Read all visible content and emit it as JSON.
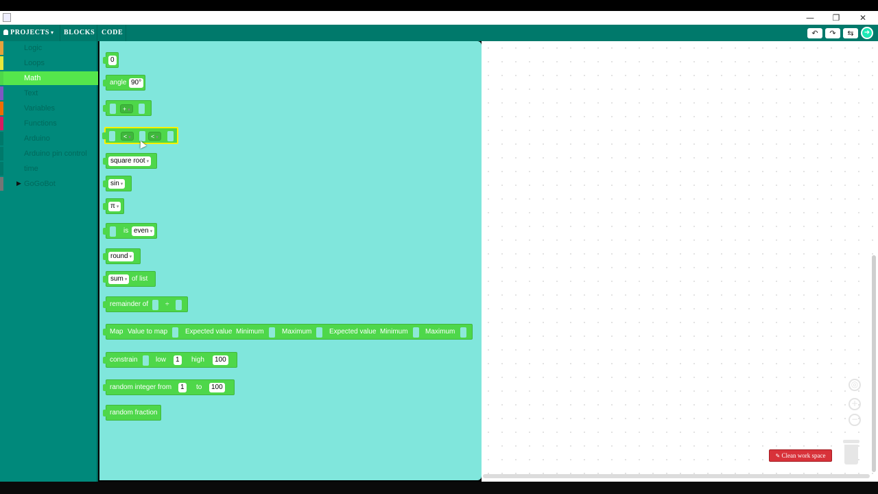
{
  "window": {
    "minimize": "—",
    "restore": "❐",
    "close": "✕"
  },
  "toolbar": {
    "projects_label": "PROJECTS",
    "projects_caret": "▾",
    "blocks_label": "BLOCKS",
    "code_label": "CODE",
    "undo_icon": "↶",
    "redo_icon": "↷",
    "connect_icon": "⇆",
    "go_icon": "➜"
  },
  "sidebar": {
    "categories": [
      {
        "label": "Logic",
        "color": "#e6a23c"
      },
      {
        "label": "Loops",
        "color": "#e6e63c"
      },
      {
        "label": "Math",
        "color": "#4ed74a",
        "selected": true
      },
      {
        "label": "Text",
        "color": "#7e57c2"
      },
      {
        "label": "Variables",
        "color": "#ef6c00"
      },
      {
        "label": "Functions",
        "color": "#d81b60"
      },
      {
        "label": "Arduino",
        "color": "#00897b"
      },
      {
        "label": "Arduino pin control",
        "color": "#00897b"
      },
      {
        "label": "time",
        "color": "#00897b"
      },
      {
        "label": "GoGoBot",
        "color": "#757575",
        "expandable": true
      }
    ]
  },
  "flyout": {
    "number": {
      "value": "0"
    },
    "angle": {
      "label": "angle",
      "value": "90°"
    },
    "arithmetic": {
      "op": "+"
    },
    "compare": {
      "op1": "<",
      "op2": "<"
    },
    "single": {
      "value": "square root"
    },
    "trig": {
      "value": "sin"
    },
    "constant": {
      "value": "π"
    },
    "number_property": {
      "label": "is",
      "value": "even"
    },
    "round": {
      "value": "round"
    },
    "on_list": {
      "value": "sum",
      "label": "of list"
    },
    "modulo": {
      "label": "remainder of",
      "op": "÷"
    },
    "map": {
      "labels": [
        "Map",
        "Value to map",
        "Expected value",
        "Minimum",
        "Maximum",
        "Expected value",
        "Minimum",
        "Maximum"
      ]
    },
    "constrain": {
      "label": "constrain",
      "low_label": "low",
      "low": "1",
      "high_label": "high",
      "high": "100"
    },
    "random_int": {
      "label": "random integer from",
      "from": "1",
      "to_label": "to",
      "to": "100"
    },
    "random_fraction": {
      "label": "random fraction"
    }
  },
  "workspace": {
    "recenter_icon": "◎",
    "zoom_in_icon": "+",
    "zoom_out_icon": "−",
    "clean_icon": "✎",
    "clean_label": "Clean work space"
  },
  "colors": {
    "toolbar": "#00796b",
    "sidebar": "#00897b",
    "flyout": "#80e6dc",
    "math_block": "#4ed74a",
    "clean_button": "#d8323a"
  }
}
